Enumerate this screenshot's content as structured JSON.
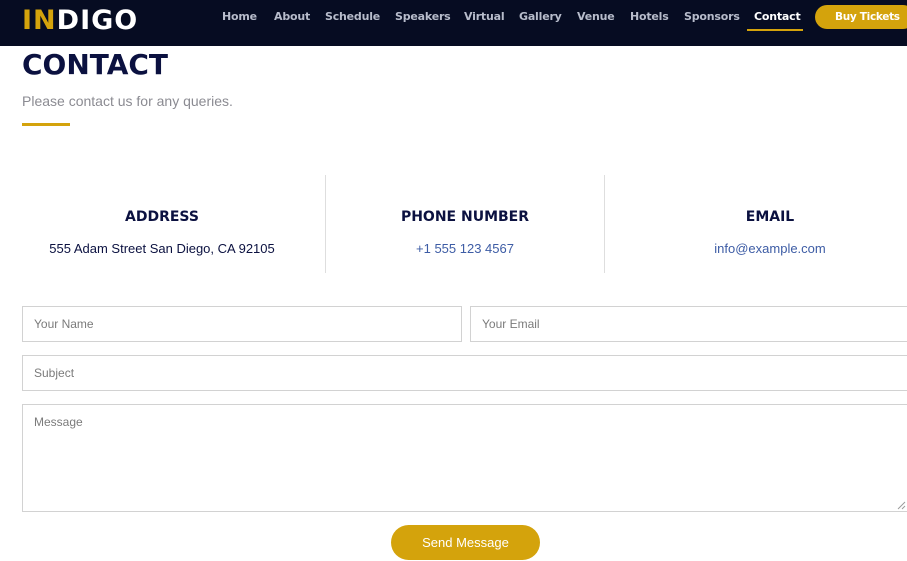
{
  "header": {
    "logo_accent": "IN",
    "logo_rest": "DIGO",
    "nav": [
      "Home",
      "About",
      "Schedule",
      "Speakers",
      "Virtual",
      "Gallery",
      "Venue",
      "Hotels",
      "Sponsors",
      "Contact"
    ],
    "active_nav": "Contact",
    "buy_tickets": "Buy Tickets"
  },
  "section": {
    "title": "CONTACT",
    "subtitle": "Please contact us for any queries."
  },
  "info": {
    "address_label": "ADDRESS",
    "address_value": "555 Adam Street San Diego, CA 92105",
    "phone_label": "PHONE NUMBER",
    "phone_value": "+1 555 123 4567",
    "email_label": "EMAIL",
    "email_value": "info@example.com"
  },
  "form": {
    "name_placeholder": "Your Name",
    "email_placeholder": "Your Email",
    "subject_placeholder": "Subject",
    "message_placeholder": "Message",
    "send_label": "Send Message"
  },
  "colors": {
    "header_bg": "#060c22",
    "accent": "#d4a30c",
    "heading": "#0b1140",
    "link": "#3d5ca5"
  }
}
